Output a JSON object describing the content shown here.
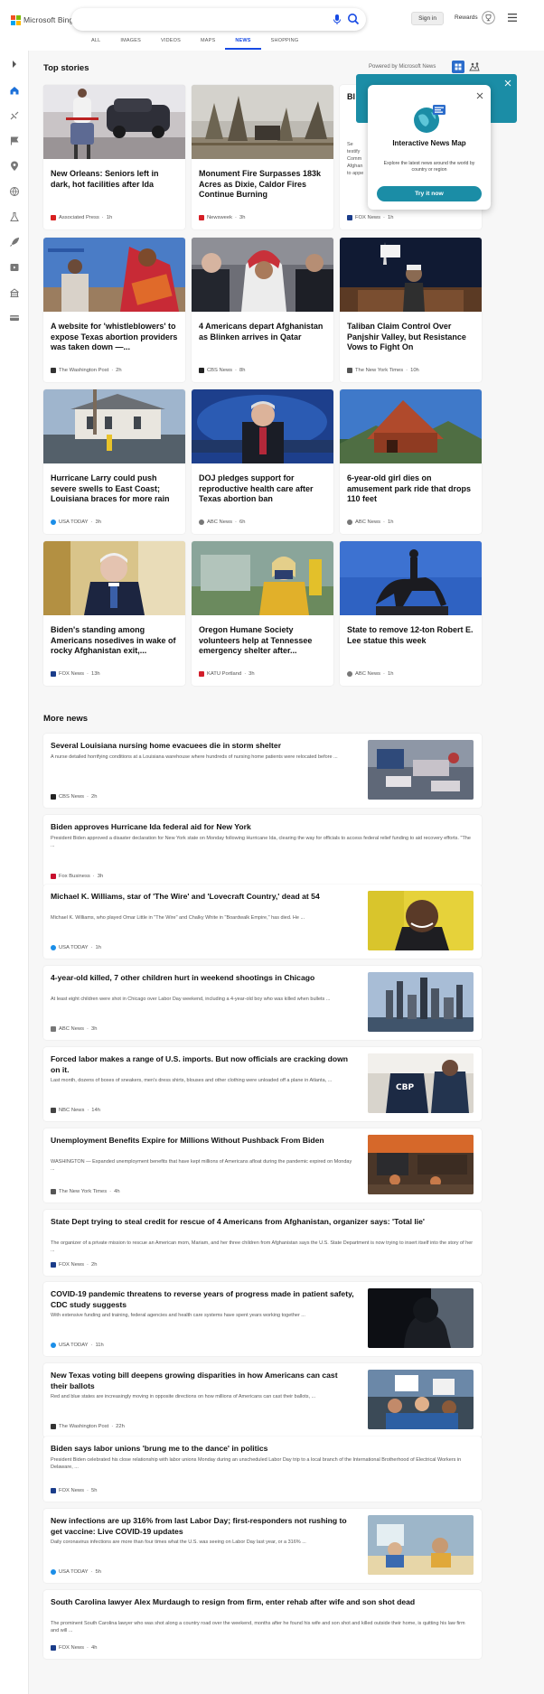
{
  "header": {
    "brand": "Microsoft Bing",
    "signin_label": "Sign in",
    "rewards_label": "Rewards",
    "tabs": [
      {
        "label": "ALL"
      },
      {
        "label": "IMAGES"
      },
      {
        "label": "VIDEOS"
      },
      {
        "label": "MAPS"
      },
      {
        "label": "NEWS"
      },
      {
        "label": "SHOPPING"
      }
    ],
    "active_tab": "NEWS"
  },
  "sidebar": {
    "icons": [
      "chevron-right-icon",
      "home-icon",
      "sports-icon",
      "flag-icon",
      "location-icon",
      "globe-icon",
      "science-icon",
      "rocket-icon",
      "entertainment-icon",
      "business-icon",
      "money-icon"
    ]
  },
  "top_stories": {
    "title": "Top stories",
    "powered_by": "Powered by Microsoft News",
    "cards": [
      {
        "title": "New Orleans: Seniors left in dark, hot facilities after Ida",
        "source": "Associated Press",
        "age": "1h",
        "logo_color": "#d82121"
      },
      {
        "title": "Monument Fire Surpasses 183k Acres as Dixie, Caldor Fires Continue Burning",
        "source": "Newsweek",
        "age": "3h",
        "logo_color": "#d61f26"
      },
      {
        "title": "Bl",
        "source": "FOX News",
        "age": "1h",
        "logo_color": "#1b3d8a",
        "partial_desc": "Se testify Comm Afghan to appe"
      },
      {
        "title": "A website for 'whistleblowers' to expose Texas abortion providers was taken down —...",
        "source": "The Washington Post",
        "age": "2h",
        "logo_color": "#333333"
      },
      {
        "title": "4 Americans depart Afghanistan as Blinken arrives in Qatar",
        "source": "CBS News",
        "age": "8h",
        "logo_color": "#222222"
      },
      {
        "title": "Taliban Claim Control Over Panjshir Valley, but Resistance Vows to Fight On",
        "source": "The New York Times",
        "age": "10h",
        "logo_color": "#555555"
      },
      {
        "title": "Hurricane Larry could push severe swells to East Coast; Louisiana braces for more rain",
        "source": "USA TODAY",
        "age": "3h",
        "logo_color": "#1b8ee8"
      },
      {
        "title": "DOJ pledges support for reproductive health care after Texas abortion ban",
        "source": "ABC News",
        "age": "6h",
        "logo_color": "#777777"
      },
      {
        "title": "6-year-old girl dies on amusement park ride that drops 110 feet",
        "source": "ABC News",
        "age": "1h",
        "logo_color": "#777777"
      },
      {
        "title": "Biden's standing among Americans nosedives in wake of rocky Afghanistan exit,...",
        "source": "FOX News",
        "age": "13h",
        "logo_color": "#1b3d8a"
      },
      {
        "title": "Oregon Humane Society volunteers help at Tennessee emergency shelter after...",
        "source": "KATU Portland",
        "age": "3h",
        "logo_color": "#d21e2b"
      },
      {
        "title": "State to remove 12-ton Robert E. Lee statue this week",
        "source": "ABC News",
        "age": "1h",
        "logo_color": "#777777"
      }
    ]
  },
  "map_popup": {
    "title": "Interactive News Map",
    "description": "Explore the latest news around the world by country or region",
    "button_label": "Try it now"
  },
  "more_news": {
    "title": "More news",
    "items": [
      {
        "title": "Several Louisiana nursing home evacuees die in storm shelter",
        "desc": "A nurse detailed horrifying conditions at a Louisiana warehouse where hundreds of nursing home patients were relocated before ...",
        "source": "CBS News",
        "age": "2h",
        "logo_color": "#222222",
        "has_image": true
      },
      {
        "title": "Biden approves Hurricane Ida federal aid for New York",
        "desc": "President Biden approved a disaster declaration for New York state on Monday following Hurricane Ida, clearing the way for officials to access federal relief funding to aid recovery efforts. \"The ...",
        "source": "Fox Business",
        "age": "3h",
        "logo_color": "#c8102e",
        "has_image": false
      },
      {
        "title": "Michael K. Williams, star of 'The Wire' and 'Lovecraft Country,' dead at 54",
        "desc": "Michael K. Williams, who played Omar Little in \"The Wire\" and Chalky White in \"Boardwalk Empire,\" has died. He ...",
        "source": "USA TODAY",
        "age": "1h",
        "logo_color": "#1b8ee8",
        "has_image": true
      },
      {
        "title": "4-year-old killed, 7 other children hurt in weekend shootings in Chicago",
        "desc": "At least eight children were shot in Chicago over Labor Day weekend, including a 4-year-old boy who was killed when bullets ...",
        "source": "ABC News",
        "age": "3h",
        "logo_color": "#777777",
        "has_image": true
      },
      {
        "title": "Forced labor makes a range of U.S. imports. But now officials are cracking down on it.",
        "desc": "Last month, dozens of boxes of sneakers, men's dress shirts, blouses and other clothing were unloaded off a plane in Atlanta, ...",
        "source": "NBC News",
        "age": "14h",
        "logo_color": "#444444",
        "has_image": true
      },
      {
        "title": "Unemployment Benefits Expire for Millions Without Pushback From Biden",
        "desc": "WASHINGTON — Expanded unemployment benefits that have kept millions of Americans afloat during the pandemic expired on Monday ...",
        "source": "The New York Times",
        "age": "4h",
        "logo_color": "#555555",
        "has_image": true
      },
      {
        "title": "State Dept trying to steal credit for rescue of 4 Americans from Afghanistan, organizer says: 'Total lie'",
        "desc": "The organizer of a private mission to rescue an American mom, Mariam, and her three children from Afghanistan says the U.S. State Department is now trying to insert itself into the story of her ...",
        "source": "FOX News",
        "age": "2h",
        "logo_color": "#1b3d8a",
        "has_image": false
      },
      {
        "title": "COVID-19 pandemic threatens to reverse years of progress made in patient safety, CDC study suggests",
        "desc": "With extensive funding and training, federal agencies and health care systems have spent years working together ...",
        "source": "USA TODAY",
        "age": "11h",
        "logo_color": "#1b8ee8",
        "has_image": true
      },
      {
        "title": "New Texas voting bill deepens growing disparities in how Americans can cast their ballots",
        "desc": "Red and blue states are increasingly moving in opposite directions on how millions of Americans can cast their ballots, ...",
        "source": "The Washington Post",
        "age": "22h",
        "logo_color": "#333333",
        "has_image": true
      },
      {
        "title": "Biden says labor unions 'brung me to the dance' in politics",
        "desc": "President Biden celebrated his close relationship with labor unions Monday during an unscheduled Labor Day trip to a local branch of the International Brotherhood of Electrical Workers in Delaware, ...",
        "source": "FOX News",
        "age": "5h",
        "logo_color": "#1b3d8a",
        "has_image": false
      },
      {
        "title": "New infections are up 316% from last Labor Day; first-responders not rushing to get vaccine: Live COVID-19 updates",
        "desc": "Daily coronavirus infections are more than four times what the U.S. was seeing on Labor Day last year, or a 316% ...",
        "source": "USA TODAY",
        "age": "5h",
        "logo_color": "#1b8ee8",
        "has_image": true
      },
      {
        "title": "South Carolina lawyer Alex Murdaugh to resign from firm, enter rehab after wife and son shot dead",
        "desc": "The prominent South Carolina lawyer who was shot along a country road over the weekend, months after he found his wife and son shot and killed outside their home, is quitting his law firm and will ...",
        "source": "FOX News",
        "age": "4h",
        "logo_color": "#1b3d8a",
        "has_image": false
      }
    ]
  }
}
